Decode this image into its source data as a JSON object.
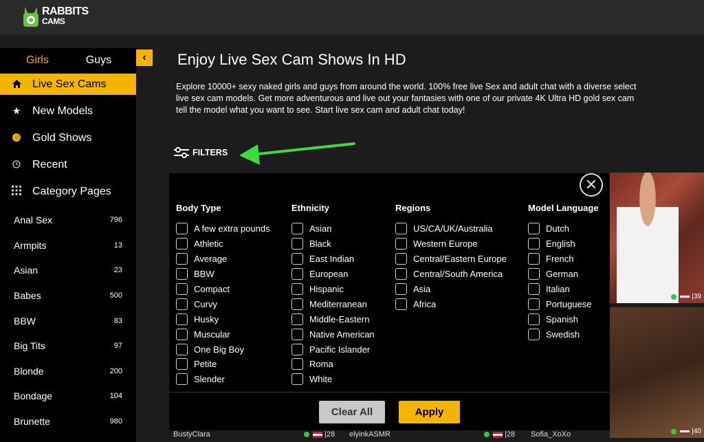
{
  "brand": {
    "line1": "RABBITS",
    "line2": "CAMS"
  },
  "sidebar": {
    "tabs": [
      {
        "label": "Girls"
      },
      {
        "label": "Guys"
      }
    ],
    "collapse_icon": "chevron-left-icon",
    "nav": [
      {
        "label": "Live Sex Cams",
        "icon": "home-icon",
        "active": true
      },
      {
        "label": "New Models",
        "icon": "star-icon"
      },
      {
        "label": "Gold Shows",
        "icon": "coin-icon"
      },
      {
        "label": "Recent",
        "icon": "clock-icon"
      },
      {
        "label": "Category Pages",
        "icon": "grid-icon"
      }
    ],
    "categories": [
      {
        "name": "Anal Sex",
        "count": "796"
      },
      {
        "name": "Armpits",
        "count": "13"
      },
      {
        "name": "Asian",
        "count": "23"
      },
      {
        "name": "Babes",
        "count": "500"
      },
      {
        "name": "BBW",
        "count": "83"
      },
      {
        "name": "Big Tits",
        "count": "97"
      },
      {
        "name": "Blonde",
        "count": "200"
      },
      {
        "name": "Bondage",
        "count": "104"
      },
      {
        "name": "Brunette",
        "count": "980"
      }
    ]
  },
  "main": {
    "title": "Enjoy Live Sex Cam Shows In HD",
    "description": [
      "Explore 10000+ sexy naked girls and guys from around the world. 100% free live Sex and adult chat with a diverse select",
      "live sex cam models. Get more adventurous and live out your fantasies with one of our private 4K Ultra HD gold sex cam",
      "tell the model what you want to see. Start live sex cam and adult chat today!"
    ],
    "filters_label": "FILTERS"
  },
  "filters": {
    "columns": [
      {
        "heading": "Body Type",
        "options": [
          "A few extra pounds",
          "Athletic",
          "Average",
          "BBW",
          "Compact",
          "Curvy",
          "Husky",
          "Muscular",
          "One Big Boy",
          "Petite",
          "Slender"
        ]
      },
      {
        "heading": "Ethnicity",
        "options": [
          "Asian",
          "Black",
          "East Indian",
          "European",
          "Hispanic",
          "Mediterranean",
          "Middle-Eastern",
          "Native American",
          "Pacific Islander",
          "Roma",
          "White"
        ]
      },
      {
        "heading": "Regions",
        "options": [
          "US/CA/UK/Australia",
          "Western Europe",
          "Central/Eastern Europe",
          "Central/South America",
          "Asia",
          "Africa"
        ]
      },
      {
        "heading": "Model Language",
        "options": [
          "Dutch",
          "English",
          "French",
          "German",
          "Italian",
          "Portuguese",
          "Spanish",
          "Swedish"
        ]
      }
    ],
    "clear_label": "Clear All",
    "apply_label": "Apply"
  },
  "thumbs": [
    {
      "viewers": "39"
    },
    {
      "viewers": "40"
    }
  ],
  "bottom_models": [
    {
      "name": "BustyClara",
      "viewers": "28"
    },
    {
      "name": "elyinkASMR",
      "viewers": "28"
    },
    {
      "name": "Sofia_XoXo",
      "viewers": ""
    }
  ],
  "colors": {
    "accent": "#f5b400",
    "panel_bg": "#000000",
    "header_bg": "#2a2a2a",
    "arrow": "#3ddc3d"
  }
}
